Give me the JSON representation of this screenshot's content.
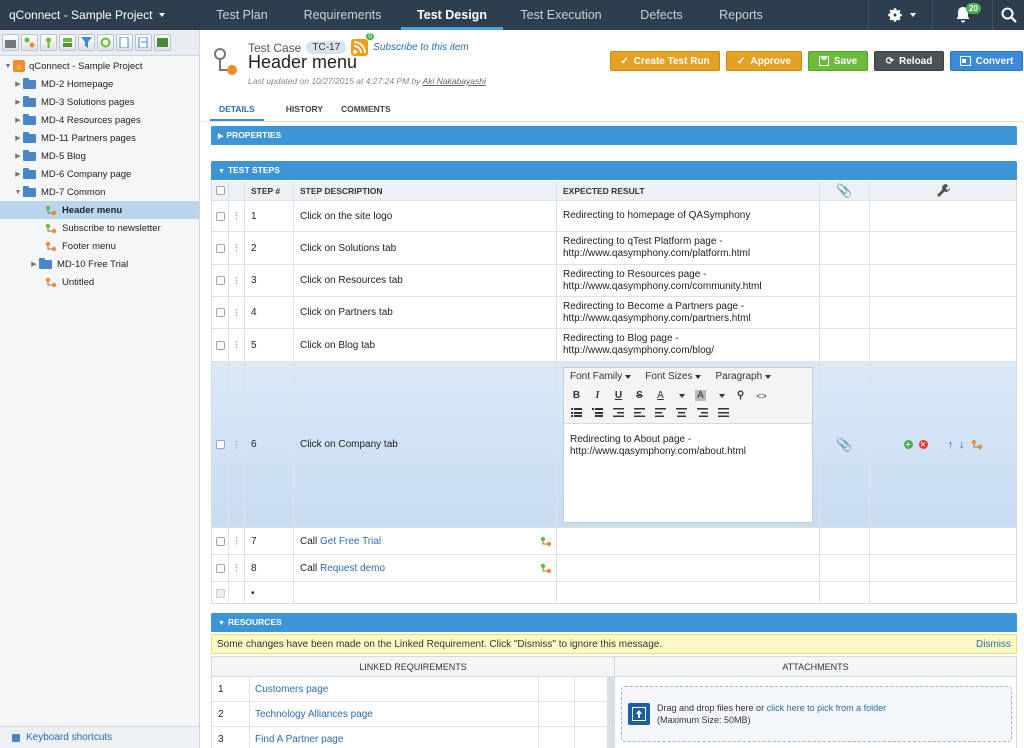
{
  "topnav": {
    "project": "qConnect - Sample Project",
    "tabs": [
      {
        "label": "Test Plan"
      },
      {
        "label": "Requirements"
      },
      {
        "label": "Test Design"
      },
      {
        "label": "Test Execution"
      },
      {
        "label": "Defects"
      },
      {
        "label": "Reports"
      }
    ],
    "active_tab": "Test Design",
    "notification_count": "20",
    "icons": [
      "gear-icon",
      "bell-icon",
      "search-icon"
    ]
  },
  "tree": {
    "toolbar_icons": [
      "new-module-icon",
      "new-test-case-icon",
      "new-child-icon",
      "move-icon",
      "filter-icon",
      "refresh-icon",
      "export-icon",
      "import-icon",
      "view-icon"
    ],
    "root": "qConnect - Sample Project",
    "items": [
      {
        "label": "MD-2 Homepage",
        "type": "folder"
      },
      {
        "label": "MD-3 Solutions pages",
        "type": "folder"
      },
      {
        "label": "MD-4 Resources pages",
        "type": "folder"
      },
      {
        "label": "MD-11 Partners pages",
        "type": "folder"
      },
      {
        "label": "MD-5 Blog",
        "type": "folder"
      },
      {
        "label": "MD-6 Company page",
        "type": "folder"
      },
      {
        "label": "MD-7 Common",
        "type": "folder",
        "expanded": true
      },
      {
        "label": "Header menu",
        "type": "testcase",
        "selected": true
      },
      {
        "label": "Subscribe to newsletter",
        "type": "testcase"
      },
      {
        "label": "Footer menu",
        "type": "testcase"
      },
      {
        "label": "MD-10 Free Trial",
        "type": "folder"
      },
      {
        "label": "Untitled",
        "type": "testcase"
      }
    ],
    "keyboard_shortcuts": "Keyboard shortcuts"
  },
  "testcase": {
    "label": "Test Case",
    "id": "TC-17",
    "rss_count": "0",
    "subscribe": "Subscribe to this item",
    "title": "Header menu",
    "updated_prefix": "Last updated on 10/27/2015 at 4:27:24 PM by",
    "updated_by": "Aki Nakabayashi"
  },
  "actions": {
    "create_run": "Create Test Run",
    "approve": "Approve",
    "save": "Save",
    "reload": "Reload",
    "convert": "Convert"
  },
  "subtabs": [
    "DETAILS",
    "HISTORY",
    "COMMENTS"
  ],
  "sections": {
    "properties": "PROPERTIES",
    "test_steps": "TEST STEPS",
    "resources": "RESOURCES"
  },
  "steps_header": {
    "step": "STEP #",
    "description": "STEP DESCRIPTION",
    "expected": "EXPECTED RESULT"
  },
  "steps": [
    {
      "num": "1",
      "desc": "Click on the site logo",
      "exp1": "Redirecting to homepage of QASymphony",
      "exp2": ""
    },
    {
      "num": "2",
      "desc": "Click on Solutions tab",
      "exp1": "Redirecting to qTest Platform page -",
      "exp2": "http://www.qasymphony.com/platform.html"
    },
    {
      "num": "3",
      "desc": "Click on Resources tab",
      "exp1": "Redirecting to Resources page -",
      "exp2": "http://www.qasymphony.com/community.html"
    },
    {
      "num": "4",
      "desc": "Click on Partners tab",
      "exp1": "Redirecting to Become a Partners page -",
      "exp2": "http://www.qasymphony.com/partners.html"
    },
    {
      "num": "5",
      "desc": "Click on Blog tab",
      "exp1": "Redirecting to Blog page -",
      "exp2": "http://www.qasymphony.com/blog/"
    },
    {
      "num": "6",
      "desc": "Click on Company tab",
      "exp1": "Redirecting to About page -",
      "exp2": "http://www.qasymphony.com/about.html"
    },
    {
      "num": "7",
      "call": "Call",
      "link": "Get Free Trial"
    },
    {
      "num": "8",
      "call": "Call",
      "link": "Request demo"
    },
    {
      "num": "•"
    }
  ],
  "editor": {
    "font_family": "Font Family",
    "font_sizes": "Font Sizes",
    "paragraph": "Paragraph",
    "bold": "B",
    "italic": "I",
    "underline": "U",
    "strike": "S",
    "text_color": "A",
    "bg_color": "A",
    "code": "<>"
  },
  "resources": {
    "notice": "Some changes have been made on the Linked Requirement. Click \"Dismiss\" to ignore this message.",
    "dismiss": "Dismiss",
    "linked_header": "LINKED REQUIREMENTS",
    "attachments_header": "ATTACHMENTS",
    "linked": [
      {
        "num": "1",
        "title": "Customers page"
      },
      {
        "num": "2",
        "title": "Technology Alliances page"
      },
      {
        "num": "3",
        "title": "Find A Partner page"
      }
    ],
    "drop_prefix": "Drag and drop files here or",
    "drop_link": "click here to pick from a folder",
    "drop_max": "(Maximum Size: 50MB)"
  },
  "colors": {
    "nav_bg": "#2d3e4f",
    "section_blue": "#3d95d5",
    "accent_link": "#2a6db0",
    "btn_orange": "#e3a224",
    "btn_green": "#6dbb3a",
    "btn_dark": "#4c5157",
    "btn_blue": "#3a8ad8",
    "notice_yellow": "#fff9c4"
  }
}
